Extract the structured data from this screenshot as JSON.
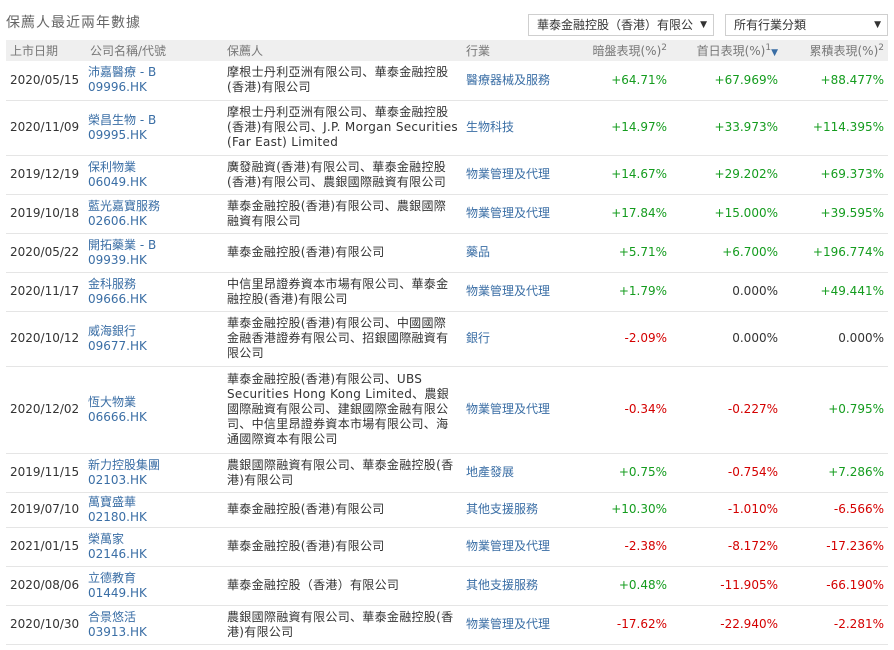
{
  "title": "保薦人最近兩年數據",
  "filters": {
    "broker": "華泰金融控股（香港）有限公",
    "industry": "所有行業分類"
  },
  "columns": {
    "date": "上市日期",
    "company": "公司名稱/代號",
    "broker": "保薦人",
    "industry": "行業",
    "grey": "暗盤表現(%)",
    "grey_sup": "2",
    "first": "首日表現(%)",
    "first_sup": "1",
    "cum": "累積表現(%)",
    "cum_sup": "2"
  },
  "rows": [
    {
      "date": "2020/05/15",
      "name": "沛嘉醫療 - B",
      "code": "09996.HK",
      "broker": "摩根士丹利亞洲有限公司、華泰金融控股(香港)有限公司",
      "industry": "醫療器械及服務",
      "grey": "+64.71%",
      "first": "+67.969%",
      "cum": "+88.477%"
    },
    {
      "date": "2020/11/09",
      "name": "榮昌生物 - B",
      "code": "09995.HK",
      "broker": "摩根士丹利亞洲有限公司、華泰金融控股(香港)有限公司、J.P. Morgan Securities (Far East) Limited",
      "industry": "生物科技",
      "grey": "+14.97%",
      "first": "+33.973%",
      "cum": "+114.395%"
    },
    {
      "date": "2019/12/19",
      "name": "保利物業",
      "code": "06049.HK",
      "broker": "廣發融資(香港)有限公司、華泰金融控股(香港)有限公司、農銀國際融資有限公司",
      "industry": "物業管理及代理",
      "grey": "+14.67%",
      "first": "+29.202%",
      "cum": "+69.373%"
    },
    {
      "date": "2019/10/18",
      "name": "藍光嘉寶服務",
      "code": "02606.HK",
      "broker": "華泰金融控股(香港)有限公司、農銀國際融資有限公司",
      "industry": "物業管理及代理",
      "grey": "+17.84%",
      "first": "+15.000%",
      "cum": "+39.595%"
    },
    {
      "date": "2020/05/22",
      "name": "開拓藥業 - B",
      "code": "09939.HK",
      "broker": "華泰金融控股(香港)有限公司",
      "industry": "藥品",
      "grey": "+5.71%",
      "first": "+6.700%",
      "cum": "+196.774%"
    },
    {
      "date": "2020/11/17",
      "name": "金科服務",
      "code": "09666.HK",
      "broker": "中信里昂證券資本市場有限公司、華泰金融控股(香港)有限公司",
      "industry": "物業管理及代理",
      "grey": "+1.79%",
      "first": "0.000%",
      "cum": "+49.441%"
    },
    {
      "date": "2020/10/12",
      "name": "威海銀行",
      "code": "09677.HK",
      "broker": "華泰金融控股(香港)有限公司、中國國際金融香港證券有限公司、招銀國際融資有限公司",
      "industry": "銀行",
      "grey": "-2.09%",
      "first": "0.000%",
      "cum": "0.000%"
    },
    {
      "date": "2020/12/02",
      "name": "恆大物業",
      "code": "06666.HK",
      "broker": "華泰金融控股(香港)有限公司、UBS Securities Hong Kong Limited、農銀國際融資有限公司、建銀國際金融有限公司、中信里昂證券資本市場有限公司、海通國際資本有限公司",
      "industry": "物業管理及代理",
      "grey": "-0.34%",
      "first": "-0.227%",
      "cum": "+0.795%"
    },
    {
      "date": "2019/11/15",
      "name": "新力控股集團",
      "code": "02103.HK",
      "broker": "農銀國際融資有限公司、華泰金融控股(香港)有限公司",
      "industry": "地產發展",
      "grey": "+0.75%",
      "first": "-0.754%",
      "cum": "+7.286%"
    },
    {
      "date": "2019/07/10",
      "name": "萬寶盛華",
      "code": "02180.HK",
      "broker": "華泰金融控股(香港)有限公司",
      "industry": "其他支援服務",
      "grey": "+10.30%",
      "first": "-1.010%",
      "cum": "-6.566%"
    },
    {
      "date": "2021/01/15",
      "name": "榮萬家",
      "code": "02146.HK",
      "broker": "華泰金融控股(香港)有限公司",
      "industry": "物業管理及代理",
      "grey": "-2.38%",
      "first": "-8.172%",
      "cum": "-17.236%"
    },
    {
      "date": "2020/08/06",
      "name": "立德教育",
      "code": "01449.HK",
      "broker": "華泰金融控股（香港）有限公司",
      "industry": "其他支援服務",
      "grey": "+0.48%",
      "first": "-11.905%",
      "cum": "-66.190%"
    },
    {
      "date": "2020/10/30",
      "name": "合景悠活",
      "code": "03913.HK",
      "broker": "農銀國際融資有限公司、華泰金融控股(香港)有限公司",
      "industry": "物業管理及代理",
      "grey": "-17.62%",
      "first": "-22.940%",
      "cum": "-2.281%"
    }
  ]
}
